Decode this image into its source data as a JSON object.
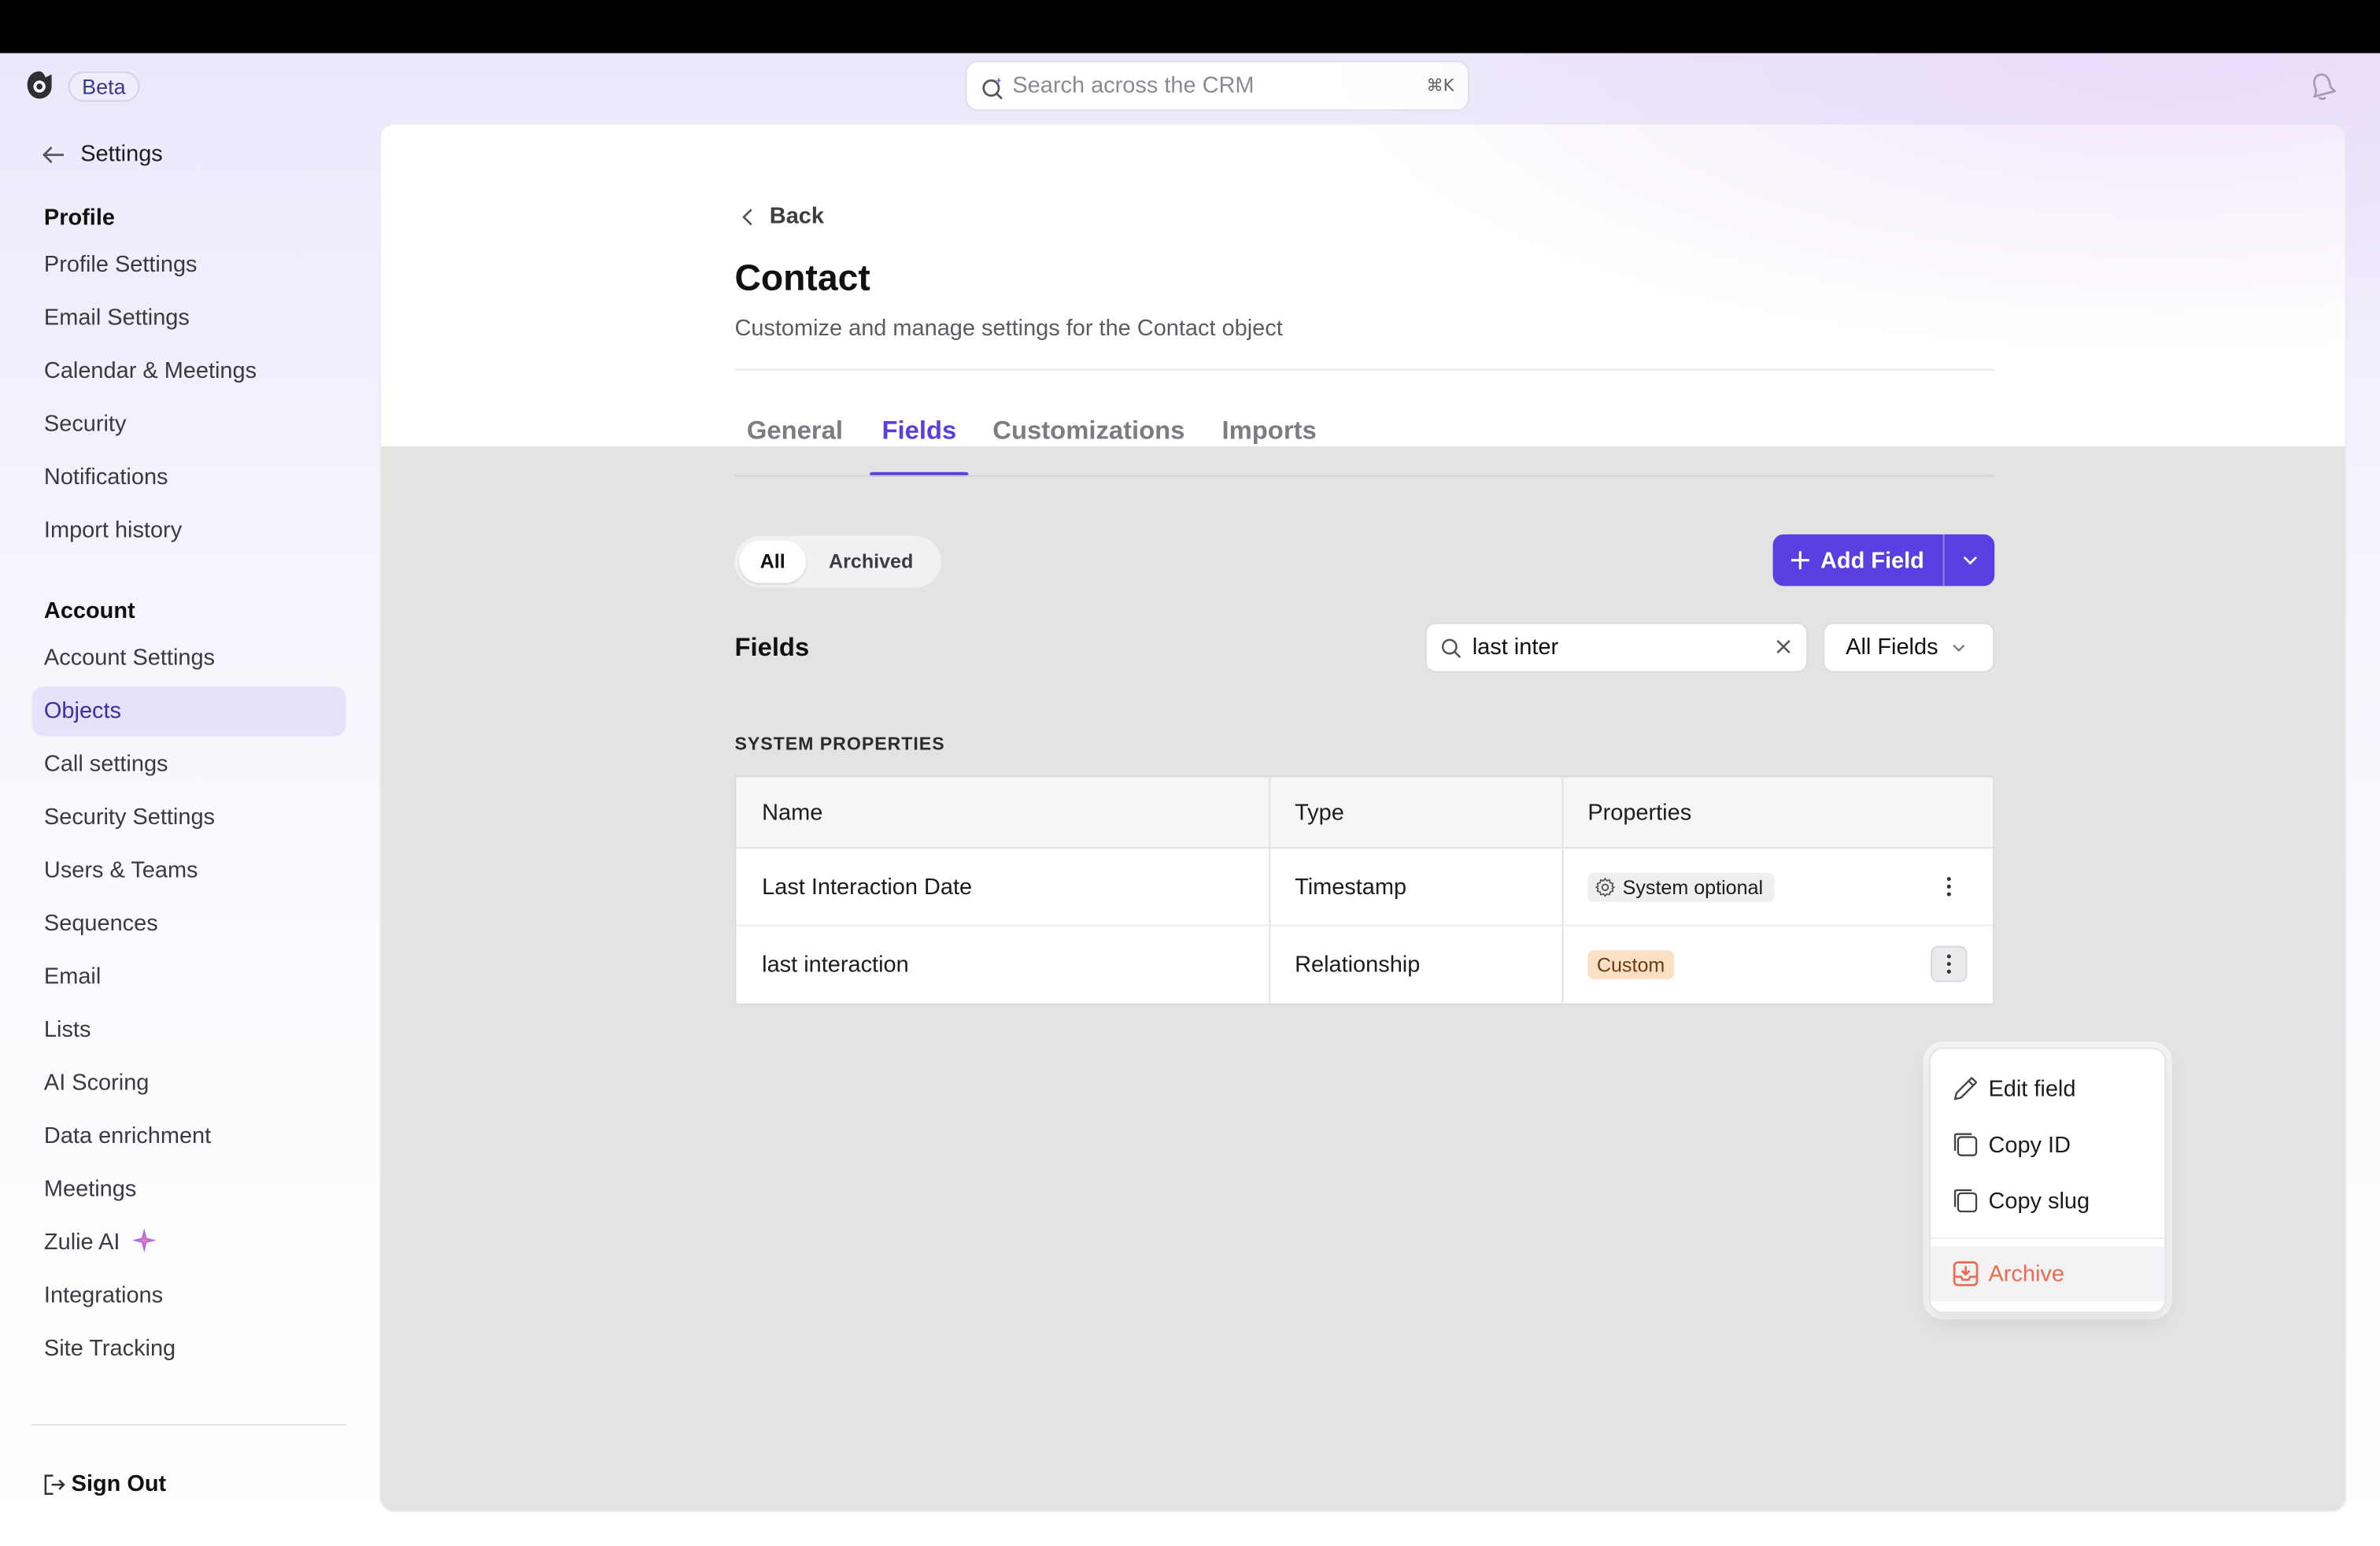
{
  "header": {
    "beta_label": "Beta",
    "search_placeholder": "Search across the CRM",
    "search_shortcut": "⌘K"
  },
  "sidebar": {
    "back_label": "Settings",
    "profile_section": "Profile",
    "profile_items": [
      "Profile Settings",
      "Email Settings",
      "Calendar & Meetings",
      "Security",
      "Notifications",
      "Import history"
    ],
    "account_section": "Account",
    "account_items": [
      "Account Settings",
      "Objects",
      "Call settings",
      "Security Settings",
      "Users & Teams",
      "Sequences",
      "Email",
      "Lists",
      "AI Scoring",
      "Data enrichment",
      "Meetings",
      "Zulie AI",
      "Integrations",
      "Site Tracking"
    ],
    "active_item": "Objects",
    "sign_out": "Sign Out"
  },
  "main": {
    "back_label": "Back",
    "title": "Contact",
    "subtitle": "Customize and manage settings for the Contact object",
    "tabs": [
      "General",
      "Fields",
      "Customizations",
      "Imports"
    ],
    "active_tab": "Fields",
    "segment": {
      "all": "All",
      "archived": "Archived"
    },
    "add_field_label": "Add Field",
    "fields_heading": "Fields",
    "search_value": "last inter",
    "filter_label": "All Fields",
    "section_label": "SYSTEM PROPERTIES",
    "table": {
      "headers": [
        "Name",
        "Type",
        "Properties"
      ],
      "rows": [
        {
          "name": "Last Interaction Date",
          "type": "Timestamp",
          "property": "System optional"
        },
        {
          "name": "last interaction",
          "type": "Relationship",
          "property": "Custom"
        }
      ]
    },
    "context_menu": {
      "edit": "Edit field",
      "copy_id": "Copy ID",
      "copy_slug": "Copy slug",
      "archive": "Archive"
    }
  },
  "colors": {
    "accent": "#5a3fe0",
    "archive": "#ee6a4d",
    "custom_tag": "#fbe0c4"
  }
}
